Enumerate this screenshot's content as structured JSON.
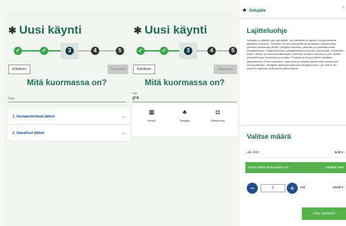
{
  "screens": [
    {
      "title": "Uusi käynti",
      "steps": [
        "✓",
        "✓",
        "3",
        "4",
        "5"
      ],
      "prev_label": "Edellinen",
      "next_label": "Seuraava",
      "question": "Mitä kuormassa on?",
      "search_label": "",
      "search_placeholder": "Hae",
      "search_value": "",
      "categories": [
        {
          "label": "1. Vastaanotettavat jätteet"
        },
        {
          "label": "2. Vaaralliset jätteet"
        }
      ]
    },
    {
      "title": "Uusi käynti",
      "steps": [
        "✓",
        "✓",
        "3",
        "4",
        "5"
      ],
      "prev_label": "Edellinen",
      "next_label": "Seuraava",
      "question": "Mitä kuormassa on?",
      "search_label": "Hae",
      "search_placeholder": "",
      "search_value": "grill",
      "results": [
        {
          "icon": "metal-icon",
          "glyph": "▦",
          "label": "Metalli"
        },
        {
          "icon": "mixed-waste-icon",
          "glyph": "♣",
          "label": "Sekajäte"
        },
        {
          "icon": "electronics-icon",
          "glyph": "◘",
          "label": "Sähköromu"
        }
      ]
    }
  ],
  "detail": {
    "icon": "mixed-waste-icon",
    "title": "Sekajäte",
    "close": "×",
    "sorting_heading": "Lajitteluohje",
    "sorting_text": "Sekajäte on jätettä, joka jää jäljelle, kun jätteestä on lajiteltu hyödynnettävät jätejakeet erikseen. Sekajäte voi olla yhtä jaetta tai sekalaista useammasta jakeesta koostuvaa jätettä. Sekajäte tarkoittaa palavaan ja palamattomaan sekajätteeseen. Palamattomaan sekajätteeseen kuuluvat pölyävä jäte, eristevillat, tuhka, hiekka- ja hiekoitusmateriaalit, kuitulevyt, eristeet, ikkunat ja ovet, lasiset kiinteistöt sekä keramiikka ja posliini. Pölyävät ja kevyet jätteet pakataan jätepusseihin. Puiset kalusteet, maa-aines ja erilaiset jätteet tulee viedä omiin keräyspisteisiin. Sekajäte lajitellaan palavaan sekajätteeseen, jos sille ei ole erikseen lajittelua osoitettavaa jätekeräystä.",
    "quantity_heading": "Valitse määrä",
    "options": [
      {
        "label": "_alle 200 l",
        "price": "6,00 €"
      },
      {
        "label": "Syötä määrä irtokuutioina m3",
        "price": "13,00 € / m3"
      }
    ],
    "quantity": "2",
    "unit": "m3",
    "total": "24,00 €",
    "add_label": "Lisää ostoskoriin"
  },
  "colors": {
    "accent": "#1e6f56",
    "done": "#3aa64a",
    "current": "#0f3d47",
    "green_button": "#56b24c",
    "link_blue": "#1f4e8a"
  }
}
